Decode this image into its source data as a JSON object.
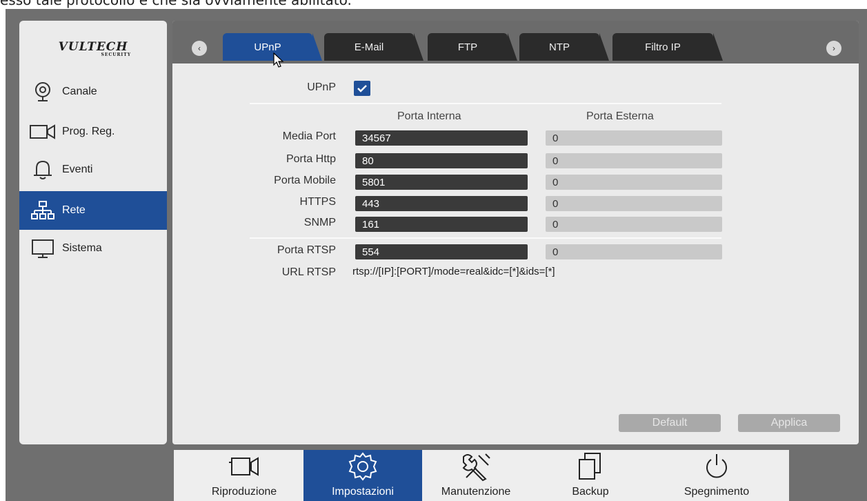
{
  "caption": "esso tale protocollo e che sia ovviamente abilitato.",
  "logo": {
    "name": "VULTECH",
    "sub": "SECURITY"
  },
  "sidebar": {
    "items": [
      {
        "label": "Canale",
        "icon": "camera-lens-icon",
        "active": false
      },
      {
        "label": "Prog. Reg.",
        "icon": "video-camera-icon",
        "active": false
      },
      {
        "label": "Eventi",
        "icon": "bell-icon",
        "active": false
      },
      {
        "label": "Rete",
        "icon": "network-icon",
        "active": true
      },
      {
        "label": "Sistema",
        "icon": "monitor-icon",
        "active": false
      }
    ]
  },
  "tabs": {
    "prev": "‹",
    "next": "›",
    "items": [
      {
        "label": "UPnP",
        "active": true
      },
      {
        "label": "E-Mail",
        "active": false
      },
      {
        "label": "FTP",
        "active": false
      },
      {
        "label": "NTP",
        "active": false
      },
      {
        "label": "Filtro IP",
        "active": false
      }
    ]
  },
  "form": {
    "upnp_label": "UPnP",
    "upnp_enabled": true,
    "col_internal": "Porta Interna",
    "col_external": "Porta Esterna",
    "rows": [
      {
        "label": "Media Port",
        "internal": "34567",
        "external": "0"
      },
      {
        "label": "Porta Http",
        "internal": "80",
        "external": "0"
      },
      {
        "label": "Porta Mobile",
        "internal": "5801",
        "external": "0"
      },
      {
        "label": "HTTPS",
        "internal": "443",
        "external": "0"
      },
      {
        "label": "SNMP",
        "internal": "161",
        "external": "0"
      }
    ],
    "rtsp": {
      "label": "Porta RTSP",
      "internal": "554",
      "external": "0"
    },
    "url_label": "URL RTSP",
    "url_value": "rtsp://[IP]:[PORT]/mode=real&idc=[*]&ids=[*]"
  },
  "buttons": {
    "default": "Default",
    "apply": "Applica"
  },
  "bottom": {
    "items": [
      {
        "label": "Riproduzione",
        "icon": "playback-camera-icon",
        "active": false
      },
      {
        "label": "Impostazioni",
        "icon": "settings-gear-icon",
        "active": true
      },
      {
        "label": "Manutenzione",
        "icon": "tools-icon",
        "active": false
      },
      {
        "label": "Backup",
        "icon": "copy-pages-icon",
        "active": false
      },
      {
        "label": "Spegnimento",
        "icon": "power-icon",
        "active": false
      }
    ]
  },
  "colors": {
    "accent": "#1f4f98",
    "dark_field": "#3a3a3a",
    "light_field": "#c9c9c9"
  }
}
